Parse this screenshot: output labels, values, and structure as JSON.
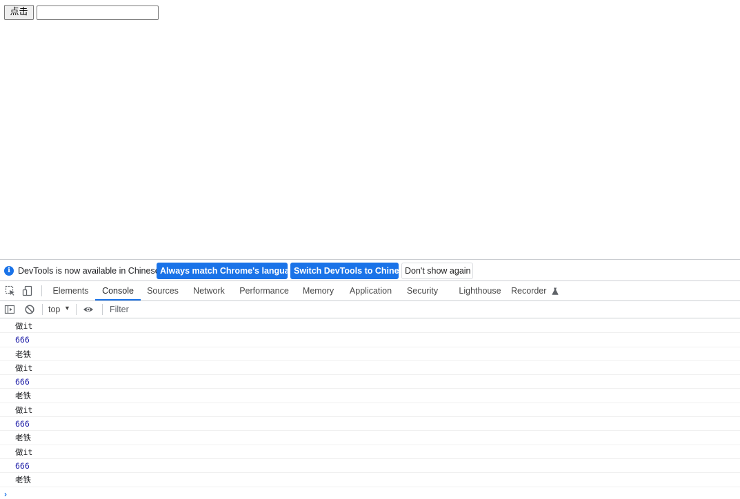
{
  "page": {
    "button_label": "点击",
    "input_value": ""
  },
  "infobar": {
    "icon": "info-icon",
    "text": "DevTools is now available in Chinese!",
    "btn_match": "Always match Chrome's language",
    "btn_switch": "Switch DevTools to Chinese",
    "btn_dismiss": "Don't show again"
  },
  "tabs": {
    "elements": "Elements",
    "console": "Console",
    "sources": "Sources",
    "network": "Network",
    "performance": "Performance",
    "memory": "Memory",
    "application": "Application",
    "security": "Security",
    "lighthouse": "Lighthouse",
    "recorder": "Recorder",
    "active": "Console"
  },
  "console_toolbar": {
    "context": "top",
    "filter_placeholder": "Filter"
  },
  "messages": [
    "做it",
    "666",
    "老铁",
    "做it",
    "666",
    "老铁",
    "做it",
    "666",
    "老铁",
    "做it",
    "666",
    "老铁"
  ],
  "colors": {
    "accent": "#1a73e8",
    "number": "#1a1aa6"
  }
}
